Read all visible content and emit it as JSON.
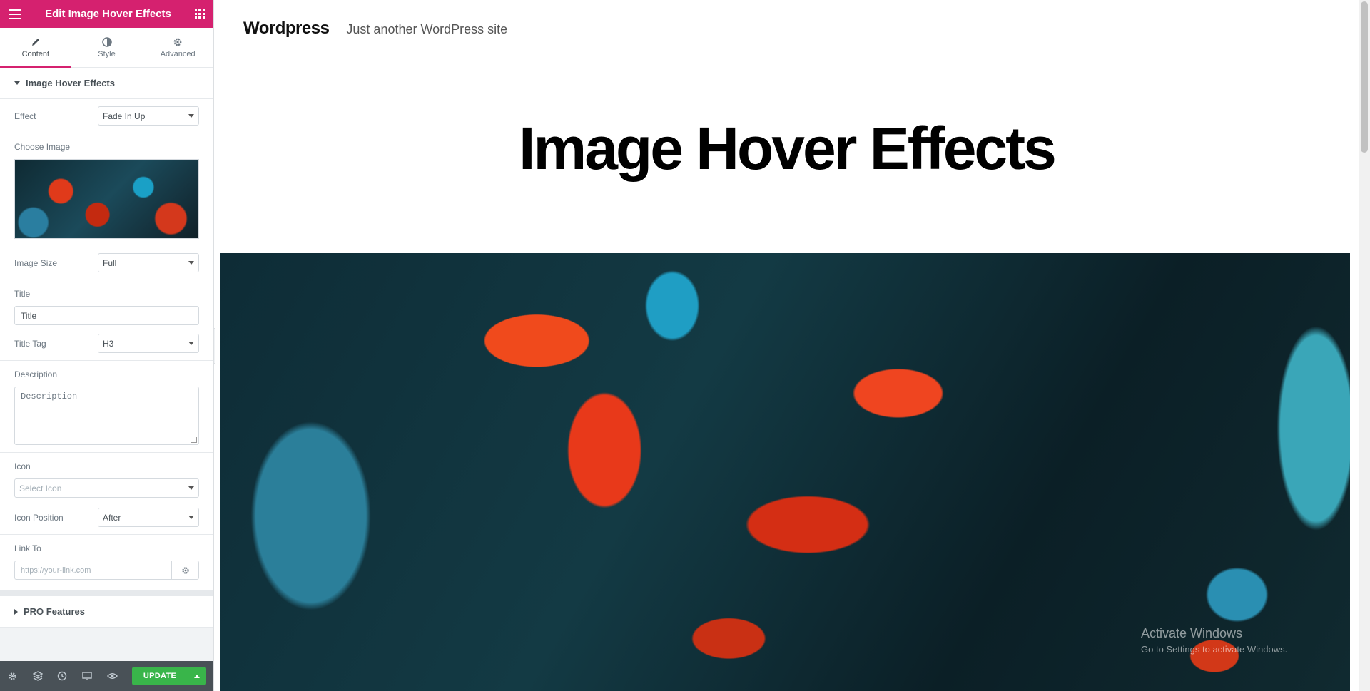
{
  "panel": {
    "header_title": "Edit Image Hover Effects",
    "tabs": [
      {
        "label": "Content"
      },
      {
        "label": "Style"
      },
      {
        "label": "Advanced"
      }
    ],
    "section_title": "Image Hover Effects",
    "effect": {
      "label": "Effect",
      "value": "Fade In Up"
    },
    "choose_image": {
      "label": "Choose Image"
    },
    "image_size": {
      "label": "Image Size",
      "value": "Full"
    },
    "title": {
      "label": "Title",
      "value": "Title"
    },
    "title_tag": {
      "label": "Title Tag",
      "value": "H3"
    },
    "description": {
      "label": "Description",
      "value": "Description"
    },
    "icon": {
      "label": "Icon",
      "placeholder": "Select Icon"
    },
    "icon_position": {
      "label": "Icon Position",
      "value": "After"
    },
    "link_to": {
      "label": "Link To",
      "placeholder": "https://your-link.com"
    },
    "pro_section": "PRO Features",
    "update_label": "UPDATE"
  },
  "preview": {
    "site_title": "Wordpress",
    "site_description": "Just another WordPress site",
    "page_title": "Image Hover Effects"
  },
  "watermark": {
    "line1": "Activate Windows",
    "line2": "Go to Settings to activate Windows."
  },
  "colors": {
    "accent": "#d5216f",
    "update": "#39b54a",
    "footer": "#495157"
  }
}
